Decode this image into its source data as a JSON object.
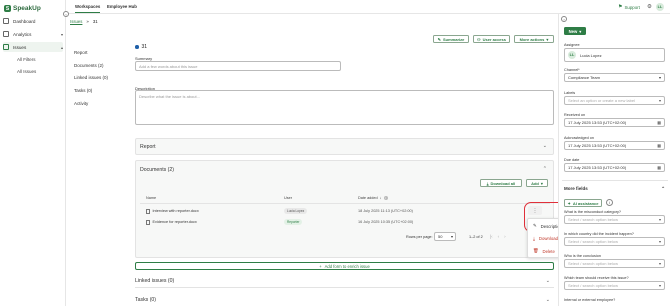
{
  "app": {
    "name": "SpeakUp"
  },
  "sidebar": {
    "items": [
      {
        "label": "Dashboard"
      },
      {
        "label": "Analytics"
      },
      {
        "label": "Issues"
      }
    ],
    "sub_items": [
      {
        "label": "All Filters"
      },
      {
        "label": "All Issues"
      }
    ]
  },
  "topbar": {
    "tabs": [
      {
        "label": "Workspaces"
      },
      {
        "label": "Employee Hub"
      }
    ],
    "support": "Support",
    "user_initials": "LL"
  },
  "breadcrumb": {
    "root": "Issues",
    "current": "31"
  },
  "issue_nav": [
    {
      "label": "Report"
    },
    {
      "label": "Documents (2)"
    },
    {
      "label": "Linked issues (0)"
    },
    {
      "label": "Tasks (0)"
    },
    {
      "label": "Activity"
    }
  ],
  "actions": {
    "summarize": "Summarize",
    "user_access": "User access",
    "more_actions": "More actions"
  },
  "issue": {
    "id": "31",
    "summary_label": "Summary",
    "summary_placeholder": "Add a few words about this issue",
    "description_label": "Description",
    "description_placeholder": "Describe what the issue is about..."
  },
  "report_section": {
    "title": "Report"
  },
  "documents_section": {
    "title": "Documents (2)",
    "download_all": "Download all",
    "add": "Add",
    "columns": [
      "Name",
      "User",
      "Date added"
    ],
    "rows": [
      {
        "name": "Interview with reporter.docx",
        "user": "Lucia Lopez",
        "date": "18 July 2025 11:13 (UTC+02:00)"
      },
      {
        "name": "Evidence for reporter.docx",
        "user": "Reporter",
        "date": "16 July 2025 10:35 (UTC+02:00)"
      }
    ],
    "rows_per_page_label": "Rows per page:",
    "rows_per_page": "50",
    "range": "1–2 of 2"
  },
  "context_menu": {
    "items": [
      {
        "label": "Description"
      },
      {
        "label": "Download"
      },
      {
        "label": "Delete"
      }
    ]
  },
  "add_form": "Add form to enrich issue",
  "linked_section": {
    "title": "Linked issues (0)"
  },
  "tasks_section": {
    "title": "Tasks (0)"
  },
  "right_panel": {
    "new_button": "New",
    "assignee_label": "Assignee",
    "assignee": "Lucia Lopez",
    "assignee_initials": "LL",
    "channel_label": "Channel*",
    "channel": "Compliance Team",
    "labels_label": "Labels",
    "labels_placeholder": "Select an option or create a new label",
    "received_label": "Received on",
    "received": "17 July 2025 13:53 (UTC+02:00)",
    "acknowledged_label": "Acknowledged on",
    "acknowledged": "17 July 2025 13:53 (UTC+02:00)",
    "due_label": "Due date",
    "due": "17 July 2025 13:53 (UTC+02:00)",
    "more_fields": "More fields",
    "ai_button": "AI assistance",
    "q1": "What is the misconduct category?",
    "q2": "In which country did the incident happen?",
    "q3": "Who is the conclusion",
    "q4": "Which team should receive this issue?",
    "q5": "Internal or external employee?",
    "select_placeholder": "Select / search option below"
  },
  "colors": {
    "brand": "#2e7d46",
    "highlight": "#e0303a"
  }
}
